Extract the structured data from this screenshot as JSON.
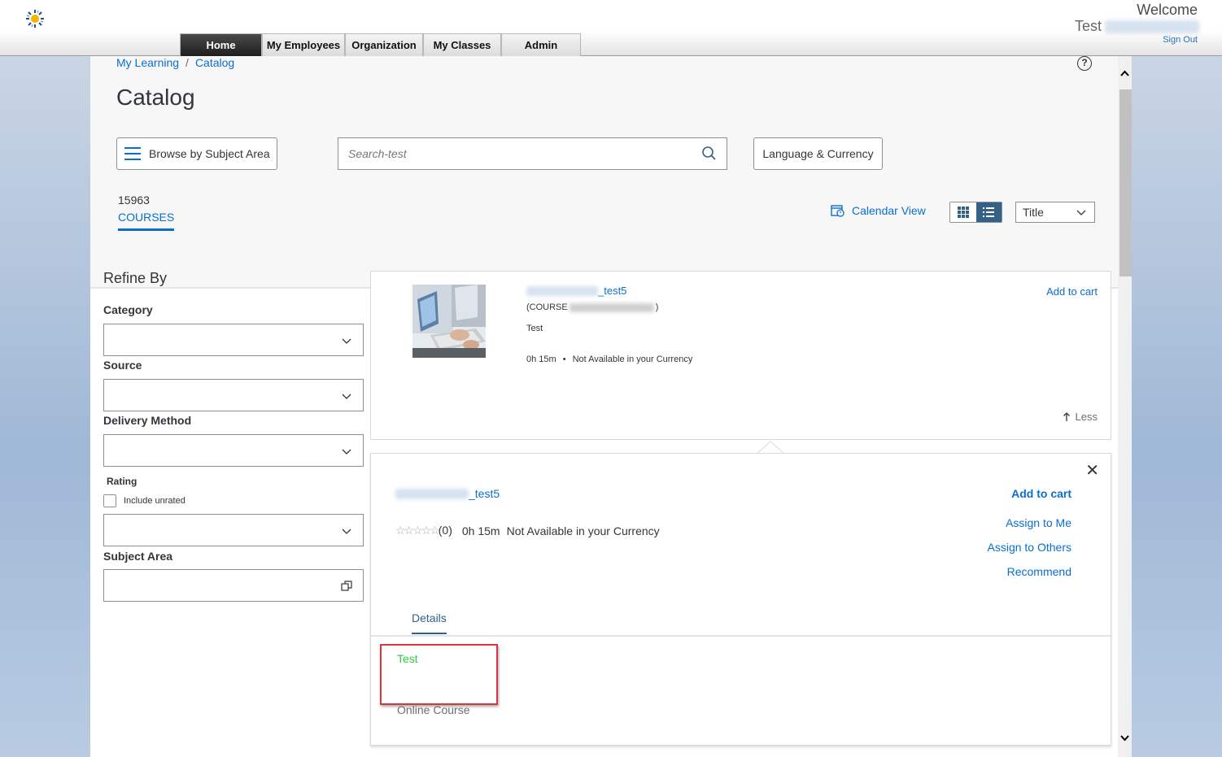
{
  "header": {
    "logo": "sunburst-logo",
    "tabs": [
      "Home",
      "My Employees",
      "Organization",
      "My Classes",
      "Admin"
    ],
    "active_tab": "Home",
    "welcome": "Welcome",
    "user_first": "Test",
    "sign_out": "Sign Out"
  },
  "breadcrumb": {
    "item1": "My Learning",
    "sep": "/",
    "item2": "Catalog"
  },
  "page": {
    "title": "Catalog",
    "browse_label": "Browse by Subject Area",
    "search_placeholder": "Search-test",
    "lang_label": "Language & Currency",
    "count": "15963",
    "courses_label": "COURSES",
    "calendar_label": "Calendar View",
    "sort_value": "Title"
  },
  "refine": {
    "title": "Refine By",
    "category": "Category",
    "source": "Source",
    "delivery": "Delivery Method",
    "rating": "Rating",
    "include_unrated": "Include unrated",
    "subject": "Subject Area"
  },
  "course": {
    "title_suffix": "_test5",
    "code_prefix": "(COURSE",
    "code_suffix": ")",
    "description": "Test",
    "duration": "0h 15m",
    "bullet": "•",
    "availability": "Not Available in your Currency",
    "add_cart": "Add to cart",
    "less": "Less"
  },
  "detail": {
    "title_suffix": "_test5",
    "rating_count": "(0)",
    "duration": "0h 15m",
    "availability": "Not Available in your Currency",
    "add_cart": "Add to cart",
    "assign_me": "Assign to Me",
    "assign_others": "Assign to Others",
    "recommend": "Recommend",
    "tab_details": "Details",
    "desc_green": "Test",
    "delivery_type": "Online Course"
  },
  "colors": {
    "link": "#0a6ed1",
    "highlight": "#d9373b",
    "green_text": "#2ecc40",
    "active_tab_bg": "#1e1e1e"
  }
}
